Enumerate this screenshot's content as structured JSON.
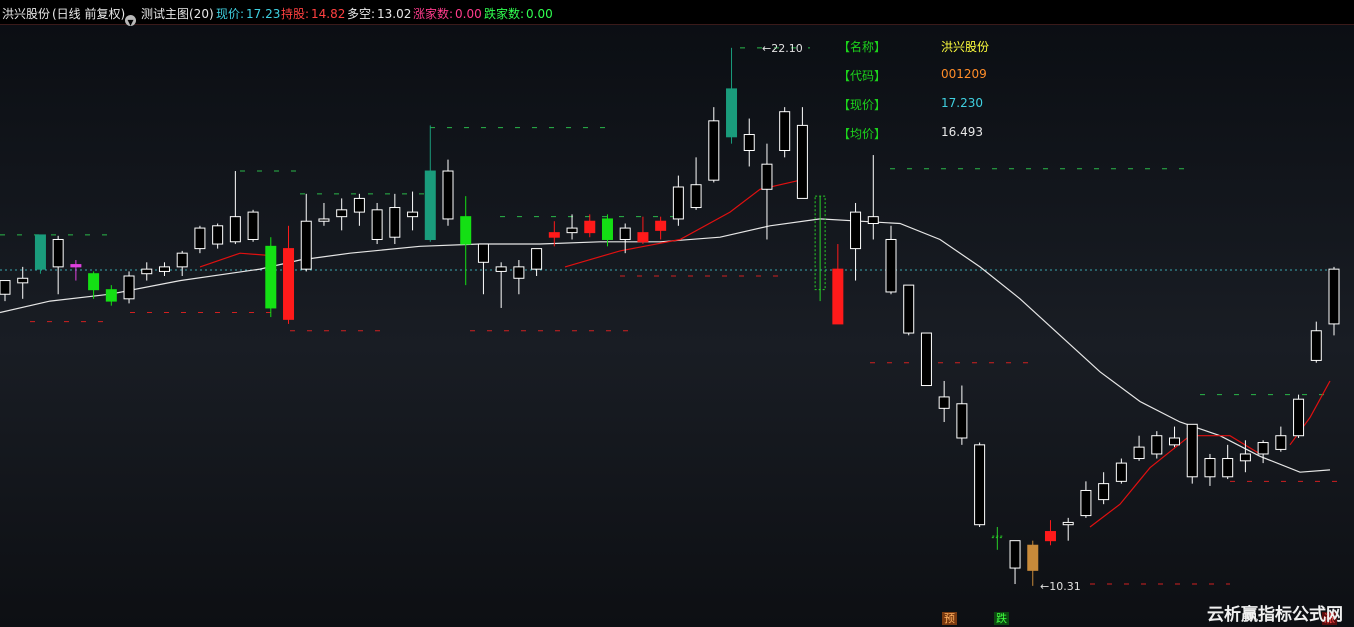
{
  "header": {
    "stock_name": "洪兴股份",
    "period": "(日线 前复权)",
    "indicator_icon": "circle-down-icon",
    "indicator": "测试主图(20)",
    "items": [
      {
        "label": "现价: ",
        "value": "17.23",
        "color": "#3fd0e0"
      },
      {
        "label": "持股: ",
        "value": "14.82",
        "color": "#ff4040"
      },
      {
        "label": "多空: ",
        "value": "13.02",
        "color": "#e8e8e8"
      },
      {
        "label": "涨家数: ",
        "value": "0.00",
        "color": "#ff3c8c"
      },
      {
        "label": "跌家数: ",
        "value": "0.00",
        "color": "#30ff50"
      }
    ]
  },
  "info_panel": [
    {
      "label": "【名称】",
      "value": "洪兴股份",
      "color": "#ffff3c"
    },
    {
      "label": "【代码】",
      "value": "001209",
      "color": "#ff8c28"
    },
    {
      "label": "【现价】",
      "value": "17.230",
      "color": "#3fd0e0"
    },
    {
      "label": "【均价】",
      "value": "16.493",
      "color": "#e8e8e8"
    }
  ],
  "markers": {
    "yu": "预",
    "die": "跌",
    "zhang": "涨"
  },
  "watermark": "云析赢指标公式网",
  "colors": {
    "up": "#ff1a1a",
    "down": "#14e014",
    "hollow_up": "#ffffff",
    "teal": "#1a9c7c",
    "ma": "#e6e6e6",
    "signal": "#e01010",
    "label": "#1cd41c"
  },
  "chart_data": {
    "type": "candlestick",
    "high_label": "22.10",
    "low_label": "10.31",
    "reference_price": 17.23,
    "y_range": [
      10.0,
      22.6
    ],
    "candles": [
      {
        "o": 16.7,
        "h": 17.0,
        "c": 17.0,
        "l": 16.55,
        "s": "w"
      },
      {
        "o": 16.95,
        "h": 17.3,
        "c": 17.05,
        "l": 16.6,
        "s": "w"
      },
      {
        "o": 17.25,
        "h": 18.0,
        "c": 18.0,
        "l": 17.15,
        "s": "t"
      },
      {
        "o": 17.3,
        "h": 17.98,
        "c": 17.9,
        "l": 16.7,
        "s": "w"
      },
      {
        "o": 17.3,
        "h": 17.45,
        "c": 17.35,
        "l": 17.0,
        "s": "m"
      },
      {
        "o": 17.15,
        "h": 17.2,
        "c": 16.8,
        "l": 16.6,
        "s": "g"
      },
      {
        "o": 16.8,
        "h": 16.9,
        "c": 16.55,
        "l": 16.45,
        "s": "g"
      },
      {
        "o": 16.6,
        "h": 17.2,
        "c": 17.1,
        "l": 16.5,
        "s": "w"
      },
      {
        "o": 17.15,
        "h": 17.4,
        "c": 17.25,
        "l": 17.0,
        "s": "w"
      },
      {
        "o": 17.2,
        "h": 17.4,
        "c": 17.3,
        "l": 17.1,
        "s": "w"
      },
      {
        "o": 17.3,
        "h": 17.65,
        "c": 17.6,
        "l": 17.1,
        "s": "w"
      },
      {
        "o": 17.7,
        "h": 18.2,
        "c": 18.15,
        "l": 17.6,
        "s": "w"
      },
      {
        "o": 17.8,
        "h": 18.25,
        "c": 18.2,
        "l": 17.7,
        "s": "w"
      },
      {
        "o": 17.85,
        "h": 19.4,
        "c": 18.4,
        "l": 17.8,
        "s": "w"
      },
      {
        "o": 17.9,
        "h": 18.55,
        "c": 18.5,
        "l": 17.85,
        "s": "w"
      },
      {
        "o": 17.75,
        "h": 17.95,
        "c": 16.4,
        "l": 16.2,
        "s": "g"
      },
      {
        "o": 17.7,
        "h": 18.2,
        "c": 16.15,
        "l": 16.05,
        "s": "r"
      },
      {
        "o": 17.25,
        "h": 18.9,
        "c": 18.3,
        "l": 17.2,
        "s": "w"
      },
      {
        "o": 18.3,
        "h": 18.7,
        "c": 18.35,
        "l": 18.2,
        "s": "w"
      },
      {
        "o": 18.4,
        "h": 18.8,
        "c": 18.55,
        "l": 18.1,
        "s": "w"
      },
      {
        "o": 18.5,
        "h": 18.9,
        "c": 18.8,
        "l": 18.2,
        "s": "w"
      },
      {
        "o": 17.9,
        "h": 18.7,
        "c": 18.55,
        "l": 17.8,
        "s": "w"
      },
      {
        "o": 17.95,
        "h": 18.9,
        "c": 18.6,
        "l": 17.8,
        "s": "w"
      },
      {
        "o": 18.4,
        "h": 18.95,
        "c": 18.5,
        "l": 18.1,
        "s": "w"
      },
      {
        "o": 19.4,
        "h": 20.4,
        "c": 17.9,
        "l": 17.85,
        "s": "t"
      },
      {
        "o": 18.35,
        "h": 19.65,
        "c": 19.4,
        "l": 18.2,
        "s": "w"
      },
      {
        "o": 18.4,
        "h": 18.85,
        "c": 17.8,
        "l": 16.9,
        "s": "g"
      },
      {
        "o": 17.4,
        "h": 17.8,
        "c": 17.8,
        "l": 16.7,
        "s": "w"
      },
      {
        "o": 17.3,
        "h": 17.4,
        "c": 17.2,
        "l": 16.4,
        "s": "w"
      },
      {
        "o": 17.3,
        "h": 17.45,
        "c": 17.05,
        "l": 16.7,
        "s": "w"
      },
      {
        "o": 17.25,
        "h": 17.6,
        "c": 17.7,
        "l": 17.1,
        "s": "w"
      },
      {
        "o": 18.05,
        "h": 18.3,
        "c": 17.95,
        "l": 17.75,
        "s": "r"
      },
      {
        "o": 18.05,
        "h": 18.45,
        "c": 18.15,
        "l": 17.9,
        "s": "w"
      },
      {
        "o": 18.3,
        "h": 18.45,
        "c": 18.05,
        "l": 17.95,
        "s": "r"
      },
      {
        "o": 18.35,
        "h": 18.45,
        "c": 17.9,
        "l": 17.75,
        "s": "g"
      },
      {
        "o": 18.15,
        "h": 18.25,
        "c": 17.9,
        "l": 17.6,
        "s": "w"
      },
      {
        "o": 18.05,
        "h": 18.4,
        "c": 17.85,
        "l": 17.8,
        "s": "r"
      },
      {
        "o": 18.3,
        "h": 18.4,
        "c": 18.1,
        "l": 17.9,
        "s": "r"
      },
      {
        "o": 18.35,
        "h": 19.3,
        "c": 19.05,
        "l": 18.2,
        "s": "w"
      },
      {
        "o": 18.6,
        "h": 19.7,
        "c": 19.1,
        "l": 18.55,
        "s": "w"
      },
      {
        "o": 19.2,
        "h": 20.8,
        "c": 20.5,
        "l": 19.15,
        "s": "w"
      },
      {
        "o": 21.2,
        "h": 22.1,
        "c": 20.15,
        "l": 20.0,
        "s": "t"
      },
      {
        "o": 19.85,
        "h": 20.55,
        "c": 20.2,
        "l": 19.5,
        "s": "w"
      },
      {
        "o": 19.0,
        "h": 20.0,
        "c": 19.55,
        "l": 17.9,
        "s": "w"
      },
      {
        "o": 19.85,
        "h": 20.8,
        "c": 20.7,
        "l": 19.7,
        "s": "w"
      },
      {
        "o": 20.4,
        "h": 20.8,
        "c": 18.8,
        "l": 18.8,
        "s": "w"
      },
      {
        "o": 18.85,
        "h": 18.85,
        "c": 16.8,
        "l": 16.55,
        "s": "d"
      },
      {
        "o": 17.25,
        "h": 17.8,
        "c": 16.05,
        "l": 16.05,
        "s": "r"
      },
      {
        "o": 17.7,
        "h": 18.7,
        "c": 18.5,
        "l": 17.0,
        "s": "w"
      },
      {
        "o": 18.4,
        "h": 19.75,
        "c": 18.25,
        "l": 17.9,
        "s": "w"
      },
      {
        "o": 17.9,
        "h": 18.2,
        "c": 16.75,
        "l": 16.7,
        "s": "w"
      },
      {
        "o": 16.9,
        "h": 16.9,
        "c": 15.85,
        "l": 15.8,
        "s": "w"
      },
      {
        "o": 15.85,
        "h": 15.85,
        "c": 14.7,
        "l": 14.7,
        "s": "w"
      },
      {
        "o": 14.45,
        "h": 14.8,
        "c": 14.2,
        "l": 13.9,
        "s": "w"
      },
      {
        "o": 14.3,
        "h": 14.7,
        "c": 13.55,
        "l": 13.4,
        "s": "w"
      },
      {
        "o": 13.4,
        "h": 13.45,
        "c": 11.65,
        "l": 11.6,
        "s": "w"
      },
      {
        "o": 11.4,
        "h": 11.6,
        "c": 11.4,
        "l": 11.1,
        "s": "d"
      },
      {
        "o": 10.7,
        "h": 11.3,
        "c": 11.3,
        "l": 10.35,
        "s": "w"
      },
      {
        "o": 10.65,
        "h": 11.3,
        "c": 11.2,
        "l": 10.31,
        "s": "o"
      },
      {
        "o": 11.3,
        "h": 11.75,
        "c": 11.5,
        "l": 11.2,
        "s": "r"
      },
      {
        "o": 11.65,
        "h": 11.8,
        "c": 11.7,
        "l": 11.3,
        "s": "w"
      },
      {
        "o": 11.85,
        "h": 12.6,
        "c": 12.4,
        "l": 11.8,
        "s": "w"
      },
      {
        "o": 12.2,
        "h": 12.8,
        "c": 12.55,
        "l": 12.1,
        "s": "w"
      },
      {
        "o": 12.6,
        "h": 13.1,
        "c": 13.0,
        "l": 12.55,
        "s": "w"
      },
      {
        "o": 13.1,
        "h": 13.6,
        "c": 13.35,
        "l": 13.05,
        "s": "w"
      },
      {
        "o": 13.2,
        "h": 13.7,
        "c": 13.6,
        "l": 13.1,
        "s": "w"
      },
      {
        "o": 13.4,
        "h": 13.8,
        "c": 13.55,
        "l": 13.35,
        "s": "w"
      },
      {
        "o": 13.85,
        "h": 13.85,
        "c": 12.7,
        "l": 12.55,
        "s": "w"
      },
      {
        "o": 12.7,
        "h": 13.2,
        "c": 13.1,
        "l": 12.5,
        "s": "w"
      },
      {
        "o": 12.7,
        "h": 13.4,
        "c": 13.1,
        "l": 12.65,
        "s": "w"
      },
      {
        "o": 13.05,
        "h": 13.5,
        "c": 13.2,
        "l": 12.8,
        "s": "w"
      },
      {
        "o": 13.2,
        "h": 13.5,
        "c": 13.45,
        "l": 13.0,
        "s": "w"
      },
      {
        "o": 13.3,
        "h": 13.8,
        "c": 13.6,
        "l": 13.25,
        "s": "w"
      },
      {
        "o": 13.6,
        "h": 14.5,
        "c": 14.4,
        "l": 13.55,
        "s": "w"
      },
      {
        "o": 15.9,
        "h": 16.1,
        "c": 15.25,
        "l": 15.2,
        "s": "w"
      },
      {
        "o": 17.25,
        "h": 17.3,
        "c": 16.05,
        "l": 15.8,
        "s": "w"
      }
    ],
    "ma_line": [
      {
        "x": 0,
        "y": 16.3
      },
      {
        "x": 50,
        "y": 16.55
      },
      {
        "x": 110,
        "y": 16.7
      },
      {
        "x": 180,
        "y": 17.0
      },
      {
        "x": 260,
        "y": 17.25
      },
      {
        "x": 300,
        "y": 17.45
      },
      {
        "x": 350,
        "y": 17.6
      },
      {
        "x": 420,
        "y": 17.75
      },
      {
        "x": 480,
        "y": 17.8
      },
      {
        "x": 540,
        "y": 17.8
      },
      {
        "x": 600,
        "y": 17.85
      },
      {
        "x": 660,
        "y": 17.85
      },
      {
        "x": 720,
        "y": 17.95
      },
      {
        "x": 770,
        "y": 18.2
      },
      {
        "x": 820,
        "y": 18.35
      },
      {
        "x": 860,
        "y": 18.3
      },
      {
        "x": 900,
        "y": 18.25
      },
      {
        "x": 940,
        "y": 17.9
      },
      {
        "x": 980,
        "y": 17.3
      },
      {
        "x": 1020,
        "y": 16.6
      },
      {
        "x": 1060,
        "y": 15.8
      },
      {
        "x": 1100,
        "y": 15.0
      },
      {
        "x": 1140,
        "y": 14.35
      },
      {
        "x": 1180,
        "y": 13.9
      },
      {
        "x": 1220,
        "y": 13.6
      },
      {
        "x": 1260,
        "y": 13.15
      },
      {
        "x": 1300,
        "y": 12.8
      },
      {
        "x": 1330,
        "y": 12.85
      }
    ],
    "signal_segments": [
      [
        {
          "x": 200,
          "y": 17.3
        },
        {
          "x": 240,
          "y": 17.6
        },
        {
          "x": 270,
          "y": 17.55
        }
      ],
      [
        {
          "x": 565,
          "y": 17.3
        },
        {
          "x": 620,
          "y": 17.65
        },
        {
          "x": 680,
          "y": 17.9
        },
        {
          "x": 730,
          "y": 18.5
        },
        {
          "x": 760,
          "y": 19.0
        },
        {
          "x": 800,
          "y": 19.2
        }
      ],
      [
        {
          "x": 1090,
          "y": 11.6
        },
        {
          "x": 1120,
          "y": 12.1
        },
        {
          "x": 1150,
          "y": 12.9
        },
        {
          "x": 1190,
          "y": 13.6
        },
        {
          "x": 1230,
          "y": 13.6
        },
        {
          "x": 1260,
          "y": 13.2
        }
      ],
      [
        {
          "x": 1290,
          "y": 13.4
        },
        {
          "x": 1310,
          "y": 14.0
        },
        {
          "x": 1330,
          "y": 14.8
        }
      ]
    ],
    "green_levels": [
      {
        "x1": 0,
        "x2": 110,
        "y": 18.0
      },
      {
        "x1": 240,
        "x2": 300,
        "y": 19.4
      },
      {
        "x1": 300,
        "x2": 430,
        "y": 18.9
      },
      {
        "x1": 430,
        "x2": 610,
        "y": 20.35
      },
      {
        "x1": 740,
        "x2": 810,
        "y": 22.1
      },
      {
        "x1": 890,
        "x2": 1190,
        "y": 19.45
      },
      {
        "x1": 1200,
        "x2": 1330,
        "y": 14.5
      },
      {
        "x1": 500,
        "x2": 680,
        "y": 18.4
      }
    ],
    "red_levels": [
      {
        "x1": 30,
        "x2": 110,
        "y": 16.1
      },
      {
        "x1": 130,
        "x2": 290,
        "y": 16.3
      },
      {
        "x1": 290,
        "x2": 380,
        "y": 15.9
      },
      {
        "x1": 470,
        "x2": 630,
        "y": 15.9
      },
      {
        "x1": 620,
        "x2": 790,
        "y": 17.1
      },
      {
        "x1": 870,
        "x2": 1030,
        "y": 15.2
      },
      {
        "x1": 1090,
        "x2": 1230,
        "y": 10.35
      },
      {
        "x1": 1230,
        "x2": 1340,
        "y": 12.6
      }
    ]
  }
}
